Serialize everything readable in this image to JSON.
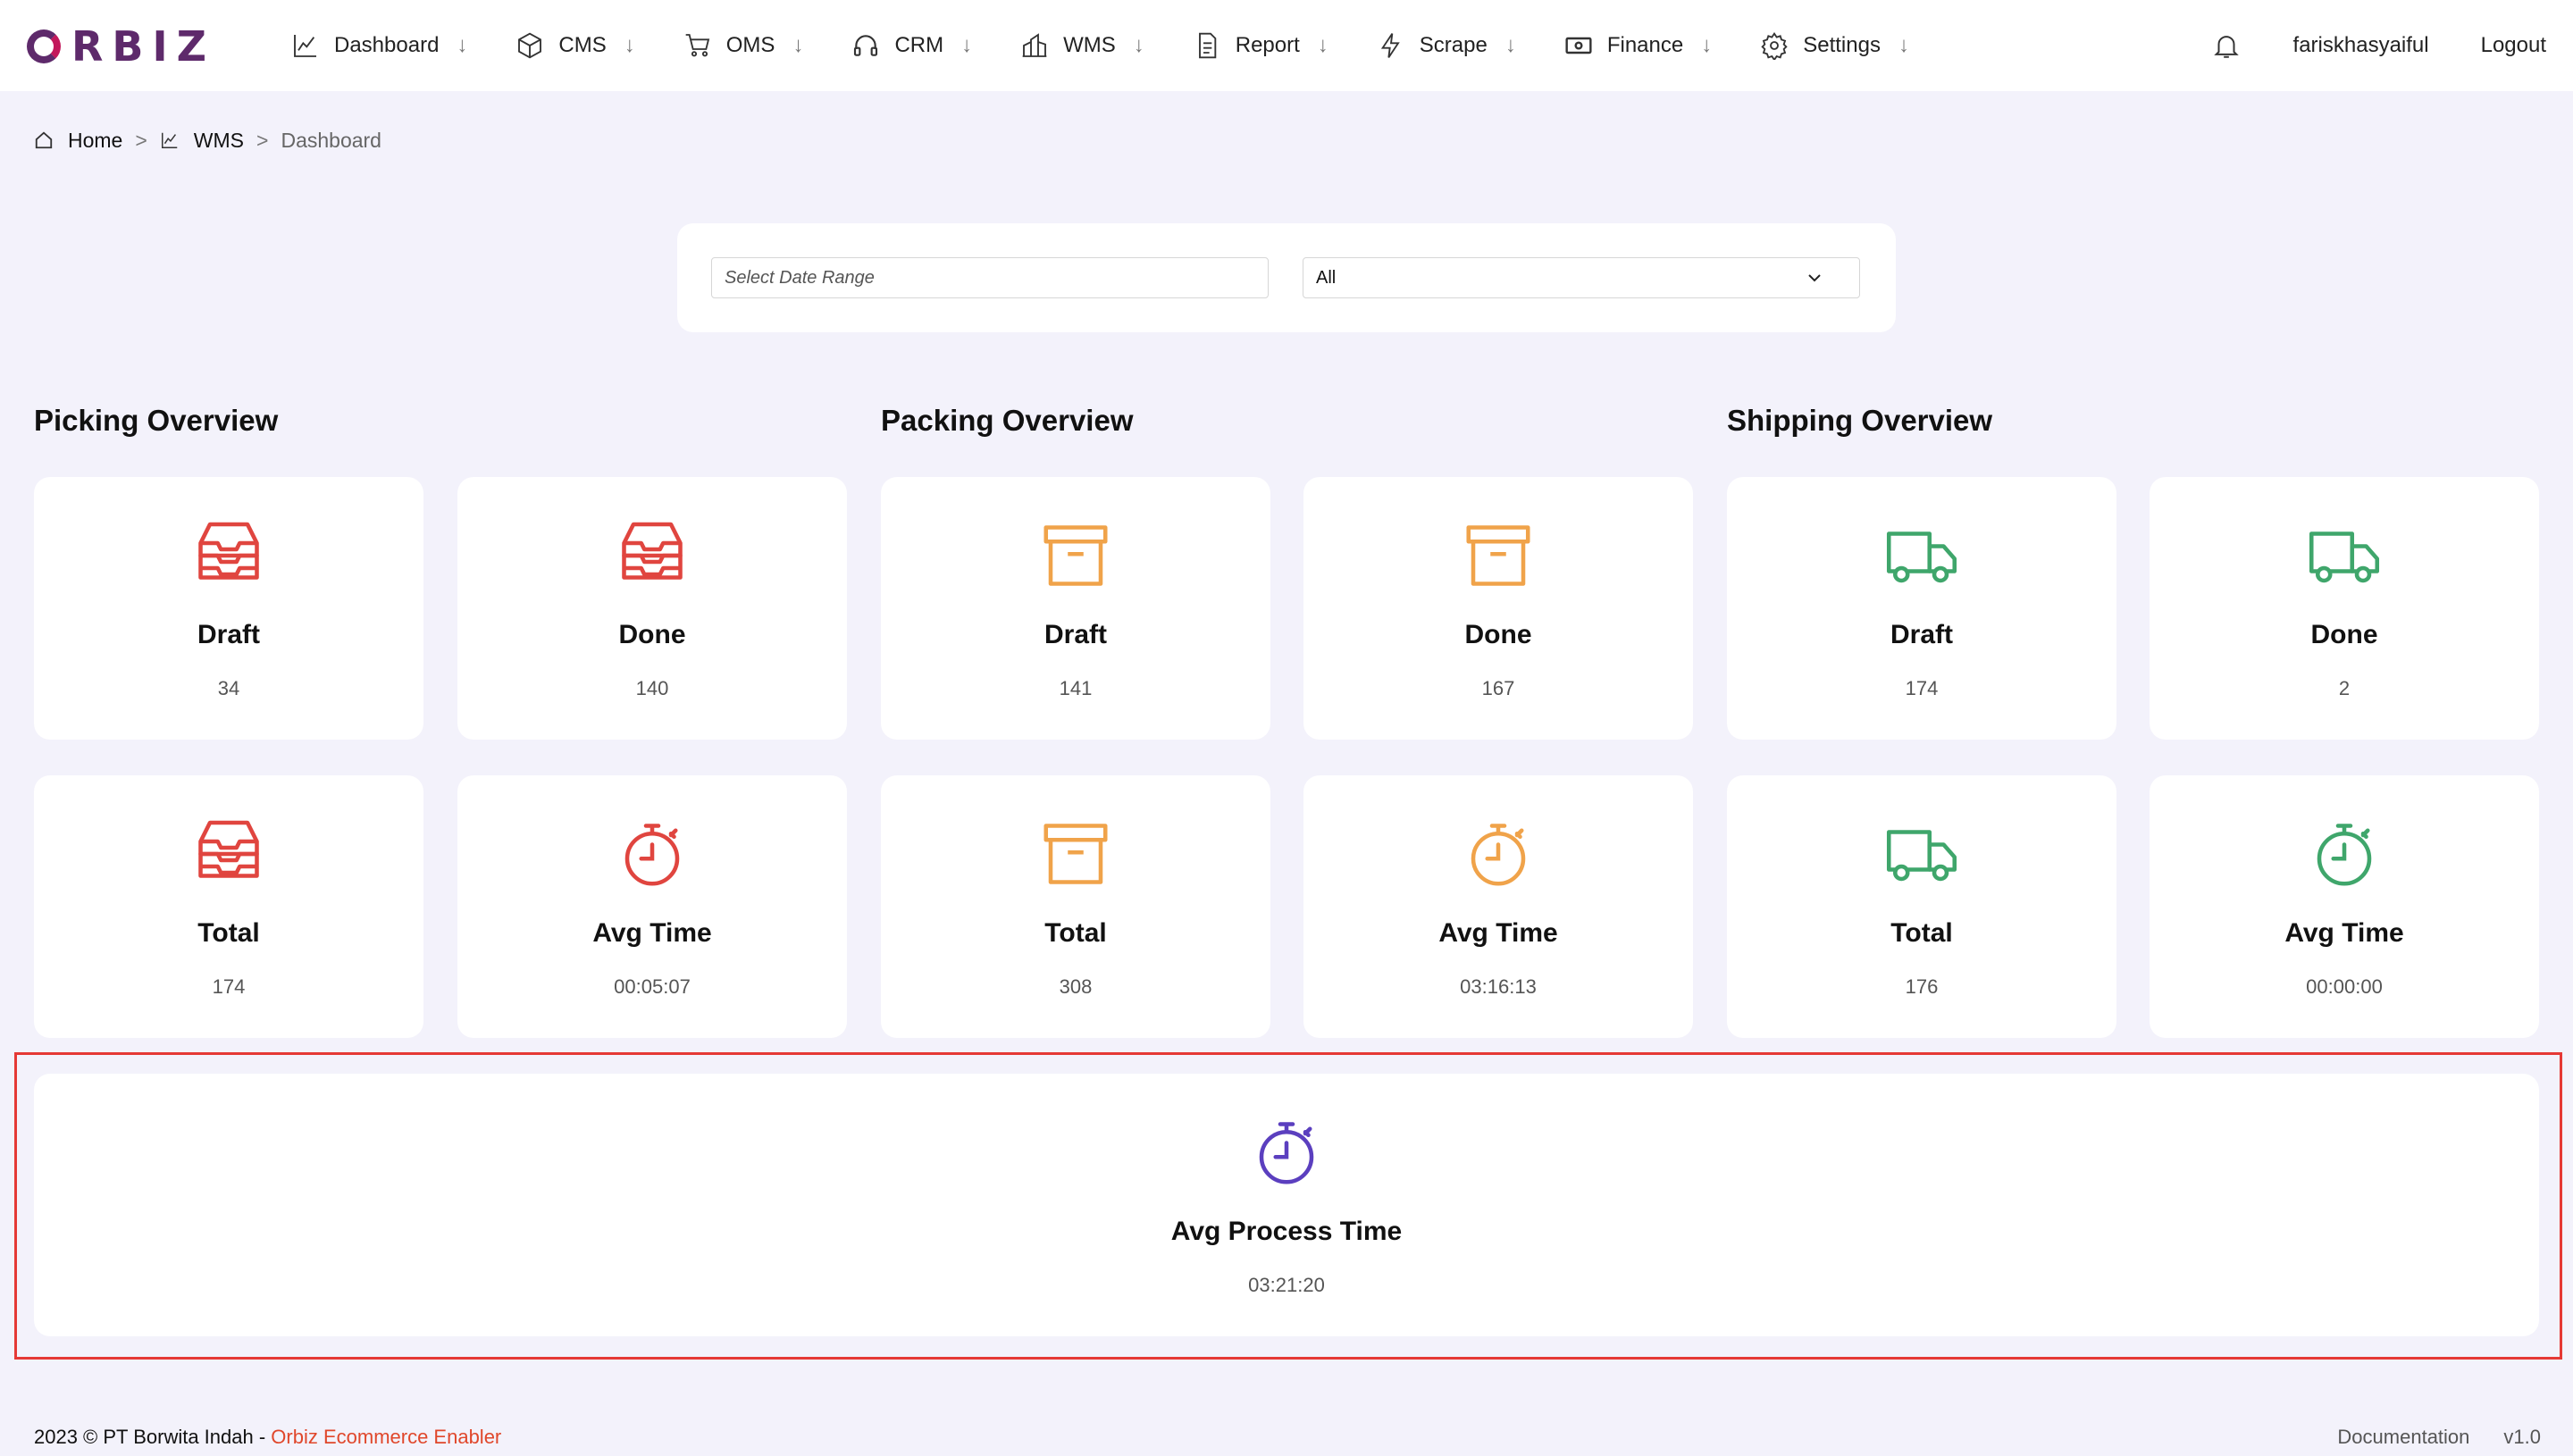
{
  "app": {
    "logo_text": "RBIZ"
  },
  "nav": {
    "items": [
      {
        "label": "Dashboard",
        "icon": "chart-line-icon"
      },
      {
        "label": "CMS",
        "icon": "box-icon"
      },
      {
        "label": "OMS",
        "icon": "cart-icon"
      },
      {
        "label": "CRM",
        "icon": "headset-icon"
      },
      {
        "label": "WMS",
        "icon": "building-icon"
      },
      {
        "label": "Report",
        "icon": "document-icon"
      },
      {
        "label": "Scrape",
        "icon": "lightning-icon"
      },
      {
        "label": "Finance",
        "icon": "cash-icon"
      },
      {
        "label": "Settings",
        "icon": "gear-icon"
      }
    ],
    "arrow": "↓",
    "username": "fariskhasyaiful",
    "logout": "Logout"
  },
  "breadcrumb": {
    "home": "Home",
    "section": "WMS",
    "current": "Dashboard",
    "separator": ">"
  },
  "filter": {
    "date_placeholder": "Select Date Range",
    "select_value": "All"
  },
  "sections": {
    "picking": {
      "title": "Picking Overview",
      "color": "#e0453f",
      "cards": [
        {
          "label": "Draft",
          "value": "34",
          "icon": "inbox-tray-icon"
        },
        {
          "label": "Done",
          "value": "140",
          "icon": "inbox-tray-icon"
        },
        {
          "label": "Total",
          "value": "174",
          "icon": "inbox-tray-icon"
        },
        {
          "label": "Avg Time",
          "value": "00:05:07",
          "icon": "stopwatch-icon"
        }
      ]
    },
    "packing": {
      "title": "Packing Overview",
      "color": "#f0a34a",
      "cards": [
        {
          "label": "Draft",
          "value": "141",
          "icon": "archive-box-icon"
        },
        {
          "label": "Done",
          "value": "167",
          "icon": "archive-box-icon"
        },
        {
          "label": "Total",
          "value": "308",
          "icon": "archive-box-icon"
        },
        {
          "label": "Avg Time",
          "value": "03:16:13",
          "icon": "stopwatch-icon"
        }
      ]
    },
    "shipping": {
      "title": "Shipping Overview",
      "color": "#3fa66b",
      "cards": [
        {
          "label": "Draft",
          "value": "174",
          "icon": "truck-icon"
        },
        {
          "label": "Done",
          "value": "2",
          "icon": "truck-icon"
        },
        {
          "label": "Total",
          "value": "176",
          "icon": "truck-icon"
        },
        {
          "label": "Avg Time",
          "value": "00:00:00",
          "icon": "stopwatch-icon"
        }
      ]
    }
  },
  "process": {
    "label": "Avg Process Time",
    "value": "03:21:20",
    "color": "#5b3fbf",
    "icon": "stopwatch-icon"
  },
  "footer": {
    "copyright": "2023 © PT Borwita Indah - ",
    "brand": "Orbiz Ecommerce Enabler",
    "documentation": "Documentation",
    "version": "v1.0"
  }
}
